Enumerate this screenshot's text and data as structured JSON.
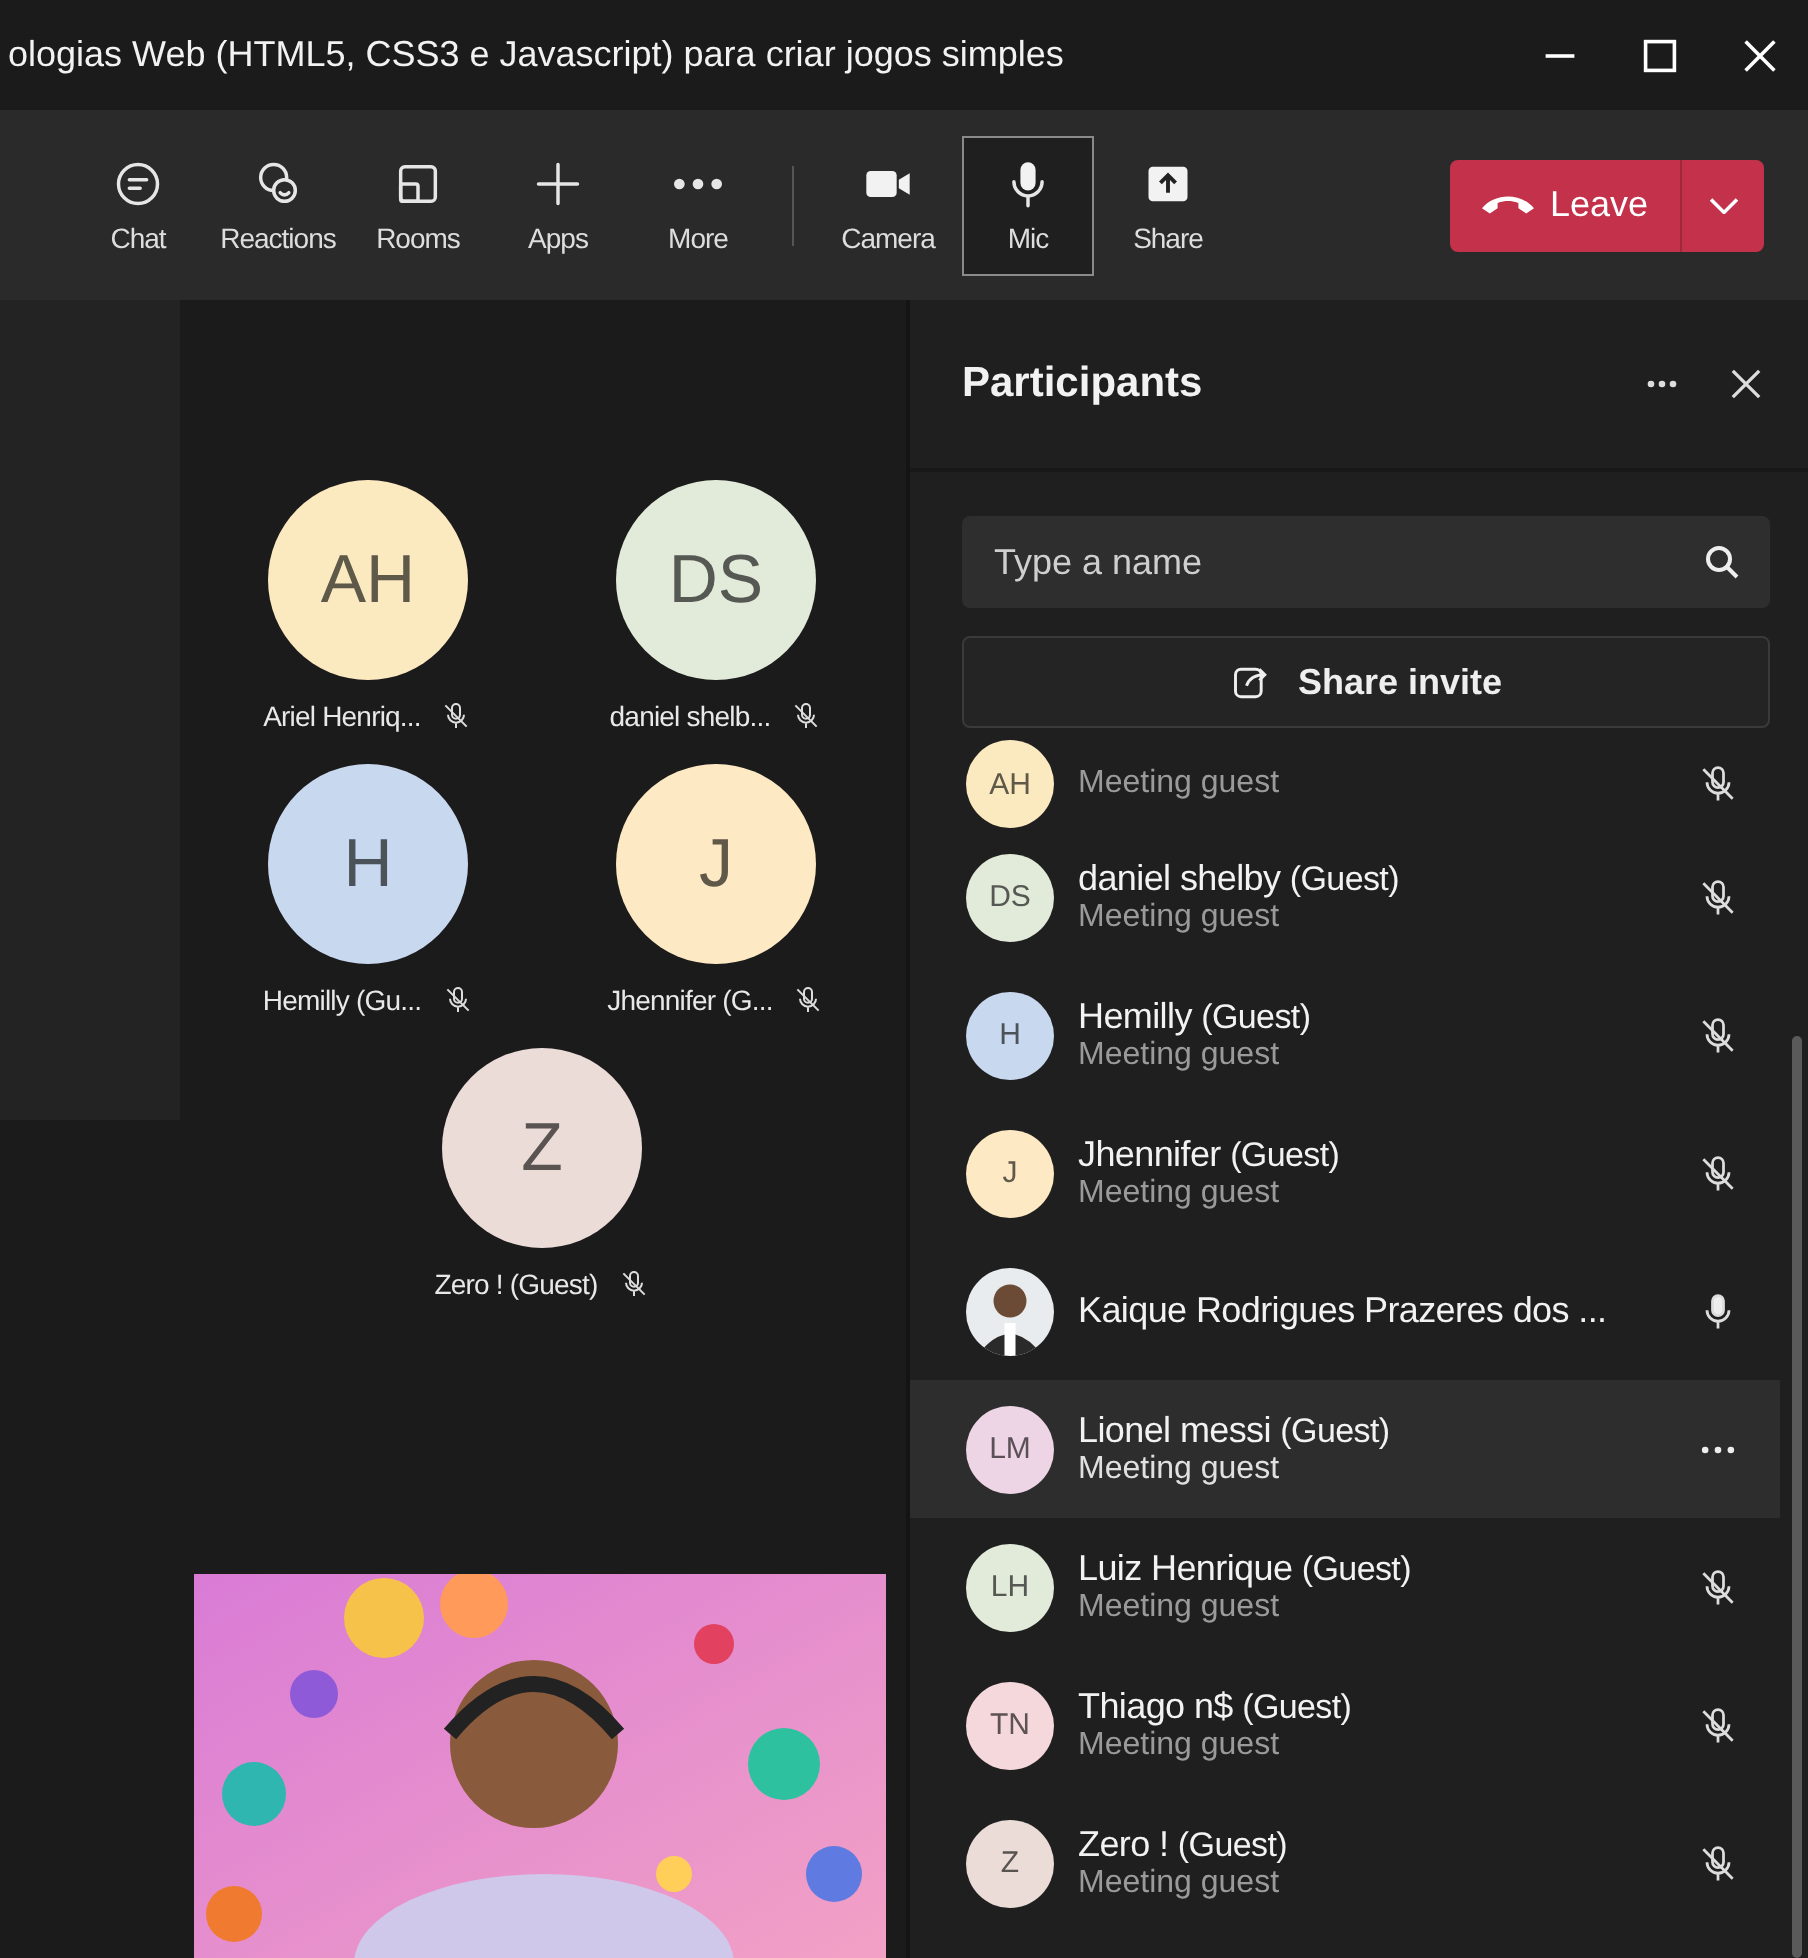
{
  "window": {
    "title": "ologias Web (HTML5, CSS3 e Javascript) para criar jogos simples"
  },
  "toolbar": [
    {
      "kind": "chat",
      "label": "Chat",
      "selected": false
    },
    {
      "kind": "reactions",
      "label": "Reactions",
      "selected": false
    },
    {
      "kind": "rooms",
      "label": "Rooms",
      "selected": false
    },
    {
      "kind": "apps",
      "label": "Apps",
      "selected": false
    },
    {
      "kind": "more",
      "label": "More",
      "selected": false
    },
    {
      "kind": "divider"
    },
    {
      "kind": "camera",
      "label": "Camera",
      "selected": false
    },
    {
      "kind": "mic",
      "label": "Mic",
      "selected": true
    },
    {
      "kind": "share",
      "label": "Share",
      "selected": false
    }
  ],
  "leave_button": {
    "label": "Leave"
  },
  "gallery": [
    {
      "initials": "AH",
      "name": "Ariel Henriq...",
      "color": "#fbe9c0",
      "muted": true
    },
    {
      "initials": "DS",
      "name": "daniel shelb...",
      "color": "#e2ebda",
      "muted": true
    },
    {
      "initials": "H",
      "name": "Hemilly (Gu...",
      "color": "#c8d8ee",
      "muted": true
    },
    {
      "initials": "J",
      "name": "Jhennifer (G...",
      "color": "#fde9c3",
      "muted": true
    },
    {
      "initials": "Z",
      "name": "Zero ! (Guest)",
      "color": "#ebdcd8",
      "muted": true
    }
  ],
  "participants_panel": {
    "title": "Participants",
    "search": {
      "placeholder": "Type a name"
    },
    "share_invite": {
      "label": "Share invite"
    },
    "participants": [
      {
        "initials": "AH",
        "color": "#fbe9c0",
        "subtitle": "Meeting guest",
        "kind": "mic",
        "muted": true,
        "highlighted": false
      },
      {
        "initials": "DS",
        "color": "#e2ebda",
        "name": "daniel shelby",
        "tag": "(Guest)",
        "subtitle": "Meeting guest",
        "kind": "mic",
        "muted": true,
        "highlighted": false
      },
      {
        "initials": "H",
        "color": "#c8d8ee",
        "name": "Hemilly",
        "tag": "(Guest)",
        "subtitle": "Meeting guest",
        "kind": "mic",
        "muted": true,
        "highlighted": false
      },
      {
        "initials": "J",
        "color": "#fde9c3",
        "name": "Jhennifer",
        "tag": "(Guest)",
        "subtitle": "Meeting guest",
        "kind": "mic",
        "muted": true,
        "highlighted": false
      },
      {
        "name": "Kaique Rodrigues Prazeres dos ...",
        "kind": "mic",
        "muted": false,
        "highlighted": false
      },
      {
        "initials": "LM",
        "color": "#eed5e5",
        "name": "Lionel messi",
        "tag": "(Guest)",
        "subtitle": "Meeting guest",
        "kind": "more",
        "highlighted": true
      },
      {
        "initials": "LH",
        "color": "#e2ebda",
        "name": "Luiz Henrique",
        "tag": "(Guest)",
        "subtitle": "Meeting guest",
        "kind": "mic",
        "muted": true,
        "highlighted": false
      },
      {
        "initials": "TN",
        "color": "#f5d8dc",
        "name": "Thiago n$",
        "tag": "(Guest)",
        "subtitle": "Meeting guest",
        "kind": "mic",
        "muted": true,
        "highlighted": false
      },
      {
        "initials": "Z",
        "color": "#ebdcd8",
        "name": "Zero !",
        "tag": "(Guest)",
        "subtitle": "Meeting guest",
        "kind": "mic",
        "muted": true,
        "highlighted": false
      }
    ]
  }
}
